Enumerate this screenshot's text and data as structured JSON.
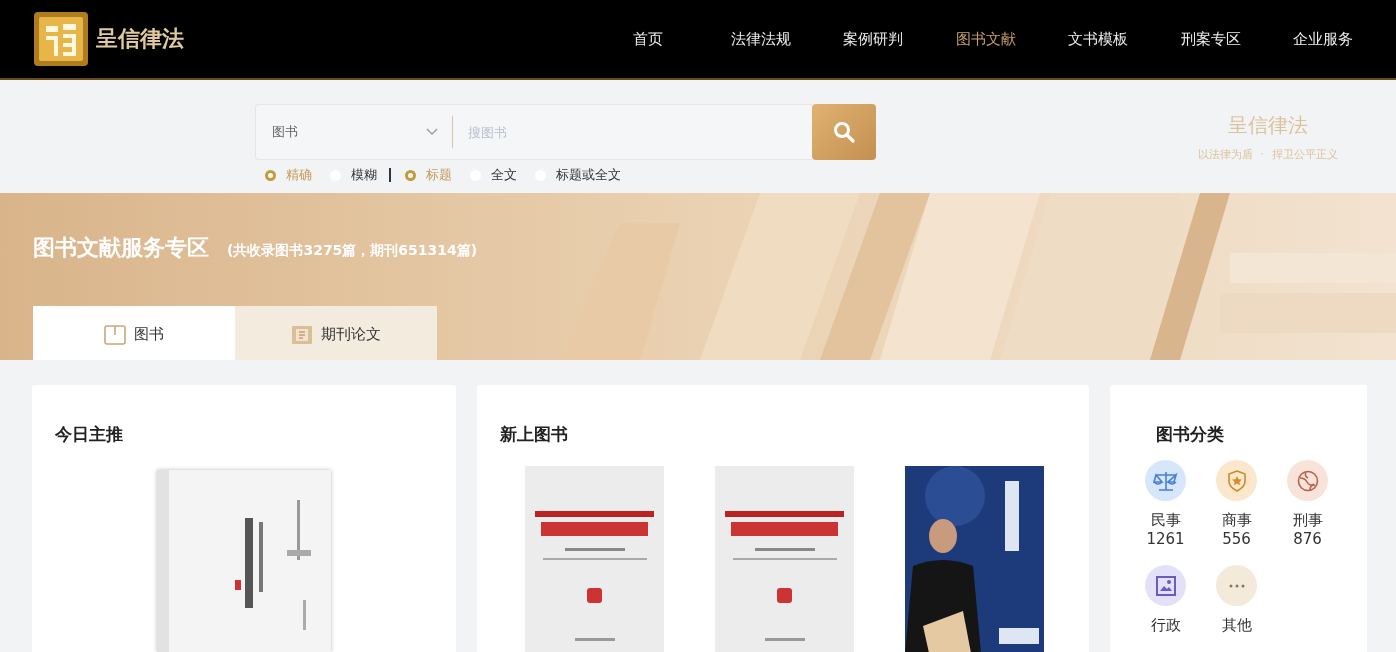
{
  "header": {
    "logo_text": "呈信律法",
    "nav": [
      {
        "label": "首页",
        "selected": false
      },
      {
        "label": "法律法规",
        "selected": false
      },
      {
        "label": "案例研判",
        "selected": false
      },
      {
        "label": "图书文献",
        "selected": true
      },
      {
        "label": "文书模板",
        "selected": false
      },
      {
        "label": "刑案专区",
        "selected": false
      },
      {
        "label": "企业服务",
        "selected": false
      }
    ]
  },
  "search": {
    "category": "图书",
    "placeholder": "搜图书",
    "match_options": [
      {
        "label": "精确",
        "selected": true
      },
      {
        "label": "模糊",
        "selected": false
      }
    ],
    "scope_options": [
      {
        "label": "标题",
        "selected": true
      },
      {
        "label": "全文",
        "selected": false
      },
      {
        "label": "标题或全文",
        "selected": false
      }
    ]
  },
  "brand": {
    "name": "呈信律法",
    "slogan_1": "以法律为盾",
    "separator": "·",
    "slogan_2": "捍卫公平正义"
  },
  "banner": {
    "title": "图书文献服务专区",
    "subtitle": "(共收录图书3275篇，期刊651314篇)",
    "tabs": [
      {
        "label": "图书",
        "selected": true,
        "kind": "book"
      },
      {
        "label": "期刊论文",
        "selected": false,
        "kind": "journal"
      }
    ]
  },
  "today_pick": {
    "title": "今日主推"
  },
  "new_books": {
    "title": "新上图书"
  },
  "categories": {
    "title": "图书分类",
    "items": [
      {
        "name": "民事",
        "count": "1261",
        "kind": "scales",
        "color": "#d6e6fb"
      },
      {
        "name": "商事",
        "count": "556",
        "kind": "badge",
        "color": "#fbe8cc"
      },
      {
        "name": "刑事",
        "count": "876",
        "kind": "globe",
        "color": "#f7e3da"
      },
      {
        "name": "行政",
        "kind": "frame",
        "color": "#e3e1f8"
      },
      {
        "name": "其他",
        "kind": "more",
        "color": "#f3ead9"
      }
    ]
  }
}
